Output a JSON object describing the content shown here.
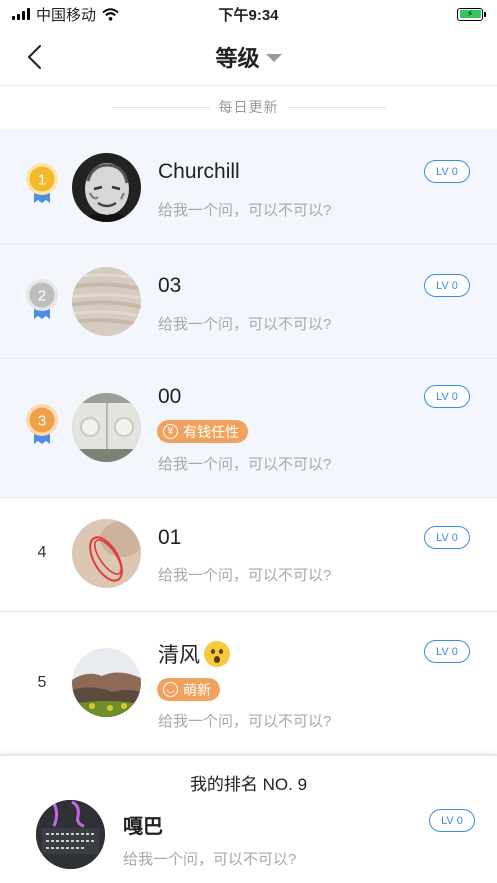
{
  "status": {
    "carrier": "中国移动",
    "time": "下午9:34"
  },
  "nav": {
    "title": "等级"
  },
  "subheader": "每日更新",
  "ranks": [
    {
      "rank": "1",
      "name": "Churchill",
      "tag": "",
      "subtitle": "给我一个问，可以不可以?",
      "level": "LV 0",
      "medal_color": "#f2b92b"
    },
    {
      "rank": "2",
      "name": "03",
      "tag": "",
      "subtitle": "给我一个问，可以不可以?",
      "level": "LV 0",
      "medal_color": "#bdbdbd"
    },
    {
      "rank": "3",
      "name": "00",
      "tag": "有钱任性",
      "subtitle": "给我一个问，可以不可以?",
      "level": "LV 0",
      "medal_color": "#f0a048"
    },
    {
      "rank": "4",
      "name": "01",
      "tag": "",
      "subtitle": "给我一个问，可以不可以?",
      "level": "LV 0"
    },
    {
      "rank": "5",
      "name": "清风",
      "tag": "萌新",
      "subtitle": "给我一个问，可以不可以?",
      "level": "LV 0"
    }
  ],
  "my_rank": {
    "title": "我的排名 NO. 9",
    "name": "嘎巴",
    "subtitle": "给我一个问，可以不可以?",
    "level": "LV 0"
  },
  "colors": {
    "accent_blue": "#3d8ae8",
    "tag_orange": "#f0a35e",
    "top_row_bg": "#f3f6fc"
  }
}
